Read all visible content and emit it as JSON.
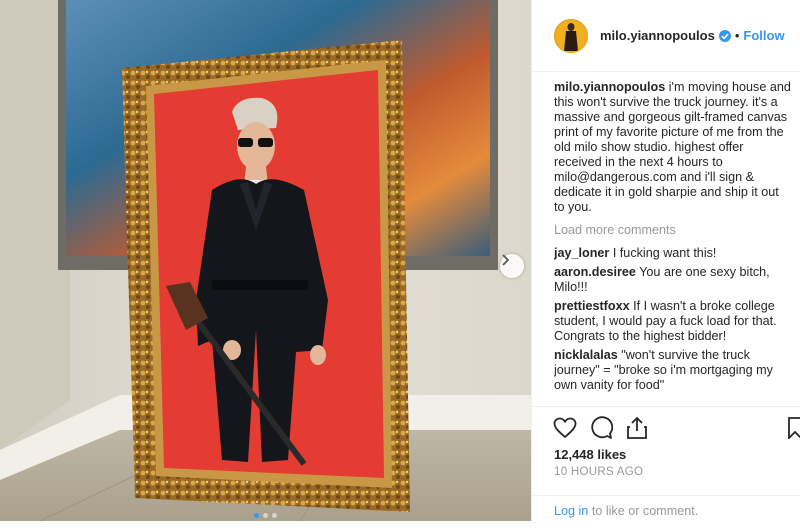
{
  "post": {
    "username": "milo.yiannopoulos",
    "follow_label": "Follow",
    "separator": "•",
    "caption_user": "milo.yiannopoulos",
    "caption_text": "i'm moving house and this won't survive the truck journey. it's a massive and gorgeous gilt-framed canvas print of my favorite picture of me from the old milo show studio. highest offer received in the next 4 hours to milo@dangerous.com and i'll sign & dedicate it in gold sharpie and ship it out to you.",
    "load_more": "Load more comments",
    "comments": [
      {
        "user": "jay_loner",
        "text": "I fucking want this!"
      },
      {
        "user": "aaron.desiree",
        "text": "You are one sexy bitch, Milo!!!"
      },
      {
        "user": "prettiestfoxx",
        "text": "If I wasn't a broke college student, I would pay a fuck load for that. Congrats to the highest bidder!"
      },
      {
        "user": "nicklalalas",
        "text": "\"won't survive the truck journey\" = \"broke so i'm mortgaging my own vanity for food\""
      }
    ],
    "likes": "12,448 likes",
    "time": "10 HOURS AGO",
    "login_link": "Log in",
    "login_rest": " to like or comment."
  },
  "icons": {
    "verified": "verified-badge-icon",
    "next": "chevron-right-icon",
    "like": "heart-icon",
    "comment": "comment-bubble-icon",
    "share": "share-icon",
    "save": "bookmark-icon"
  },
  "colors": {
    "accent": "#3897f0",
    "muted": "#999999",
    "text": "#262626",
    "avatar_bg": "#f0b020"
  },
  "carousel": {
    "total": 3,
    "active": 1
  }
}
